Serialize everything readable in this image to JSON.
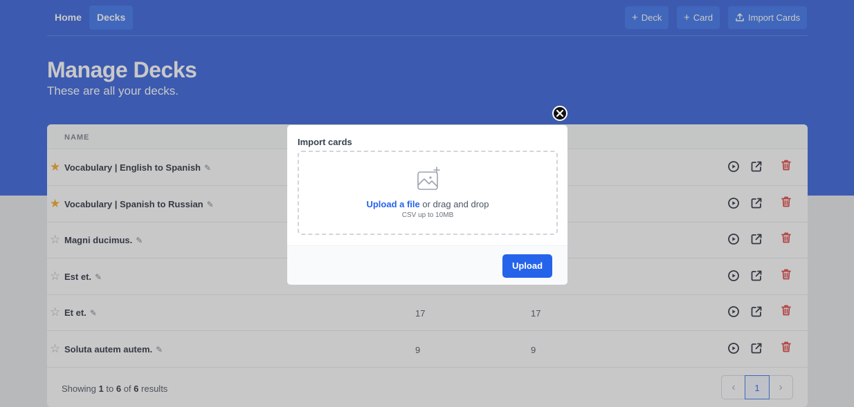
{
  "nav": {
    "home_label": "Home",
    "decks_label": "Decks",
    "add_deck_label": "Deck",
    "add_card_label": "Card",
    "import_label": "Import Cards"
  },
  "page": {
    "title": "Manage Decks",
    "subtitle": "These are all your decks."
  },
  "table": {
    "columns": {
      "name": "NAME"
    },
    "rows": [
      {
        "name": "Vocabulary | English to Spanish",
        "favorite": true,
        "col2": "",
        "col3": ""
      },
      {
        "name": "Vocabulary | Spanish to Russian",
        "favorite": true,
        "col2": "",
        "col3": ""
      },
      {
        "name": "Magni ducimus.",
        "favorite": false,
        "col2": "",
        "col3": ""
      },
      {
        "name": "Est et.",
        "favorite": false,
        "col2": "",
        "col3": ""
      },
      {
        "name": "Et et.",
        "favorite": false,
        "col2": "17",
        "col3": "17"
      },
      {
        "name": "Soluta autem autem.",
        "favorite": false,
        "col2": "9",
        "col3": "9"
      }
    ]
  },
  "footer": {
    "showing_prefix": "Showing",
    "from": "1",
    "to_word": "to",
    "to": "6",
    "of_word": "of",
    "total": "6",
    "results_word": "results",
    "current_page": "1"
  },
  "modal": {
    "title": "Import cards",
    "upload_link": "Upload a file",
    "drag_text": "or drag and drop",
    "hint": "CSV up to 10MB",
    "upload_button": "Upload"
  },
  "icons": {
    "star_on": "★",
    "star_off": "☆",
    "pencil": "✎",
    "plus": "+",
    "chevron_left": "‹",
    "chevron_right": "›"
  },
  "colors": {
    "brand": "#1d4ed8",
    "primary": "#2563eb",
    "delete": "#dc2626",
    "star": "#f59e0b"
  }
}
